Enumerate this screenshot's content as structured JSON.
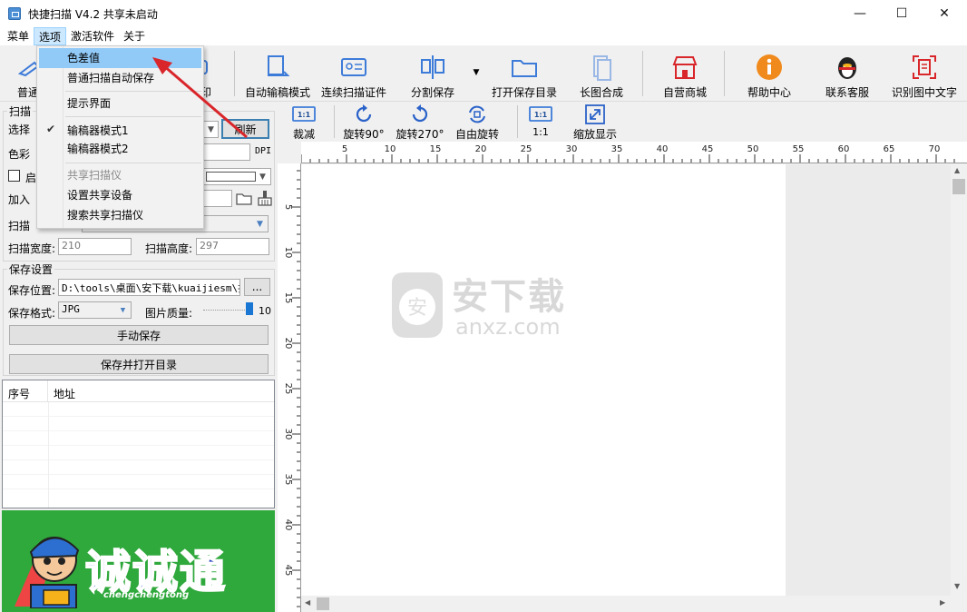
{
  "window": {
    "title": "快捷扫描 V4.2 共享未启动",
    "minimize": "—",
    "maximize": "☐",
    "close": "✕"
  },
  "menubar": {
    "items": [
      "菜单",
      "选项",
      "激活软件",
      "关于"
    ]
  },
  "options_menu": {
    "items": [
      {
        "label": "色差值"
      },
      {
        "label": "普通扫描自动保存"
      },
      {
        "label": "提示界面"
      },
      {
        "label": "输稿器模式1"
      },
      {
        "label": "输稿器模式2"
      },
      {
        "label": "共享扫描仪"
      },
      {
        "label": "设置共享设备"
      },
      {
        "label": "搜索共享扫描仪"
      }
    ]
  },
  "toolbar": {
    "partial_left": "普通",
    "partial_print": "印",
    "auto_feeder": "自动输稿模式",
    "continuous_id": "连续扫描证件",
    "split_save": "分割保存",
    "open_dir": "打开保存目录",
    "long_image": "长图合成",
    "store": "自营商城",
    "help": "帮助中心",
    "support": "联系客服",
    "ocr": "识别图中文字"
  },
  "left": {
    "scan_group_partial": "扫描",
    "select_partial": "选择",
    "refresh": "刷新",
    "color_partial": "色彩",
    "dpi": "DPI",
    "enable_partial": "启",
    "add_partial": "加入",
    "scan_partial": "扫描",
    "scan_width_label": "扫描宽度:",
    "scan_width_value": "210",
    "scan_height_label": "扫描高度:",
    "scan_height_value": "297",
    "save_group": "保存设置",
    "save_location_label": "保存位置:",
    "save_location_value": "D:\\tools\\桌面\\安下载\\kuaijiesm\\扫",
    "browse": "...",
    "save_format_label": "保存格式:",
    "save_format_value": "JPG",
    "quality_label": "图片质量:",
    "quality_value": "10",
    "manual_save": "手动保存",
    "save_open_dir": "保存并打开目录",
    "col_no": "序号",
    "col_address": "地址",
    "banner_text": "诚诚通",
    "banner_sub": "chengchengtong"
  },
  "right_toolbar": {
    "crop": "裁减",
    "crop_icon": "1:1",
    "rotate90": "旋转90°",
    "rotate270": "旋转270°",
    "free_rotate": "自由旋转",
    "one_to_one": "1:1",
    "one_to_one_icon": "1:1",
    "fit": "缩放显示"
  },
  "ruler": {
    "h_labels": [
      "5",
      "10",
      "15",
      "20",
      "25",
      "30",
      "35",
      "40",
      "45",
      "50",
      "55",
      "60",
      "65",
      "70"
    ],
    "v_labels": [
      "5",
      "10",
      "15",
      "20",
      "25",
      "30",
      "35",
      "40",
      "45"
    ]
  },
  "watermark": {
    "cn": "安下载",
    "url": "anxz.com"
  },
  "colors": {
    "highlight": "#91c9f7",
    "menu_active": "#cce8ff",
    "banner_green": "#2fa83c",
    "arrow_red": "#d9262b",
    "icon_blue": "#3d7bd9"
  }
}
